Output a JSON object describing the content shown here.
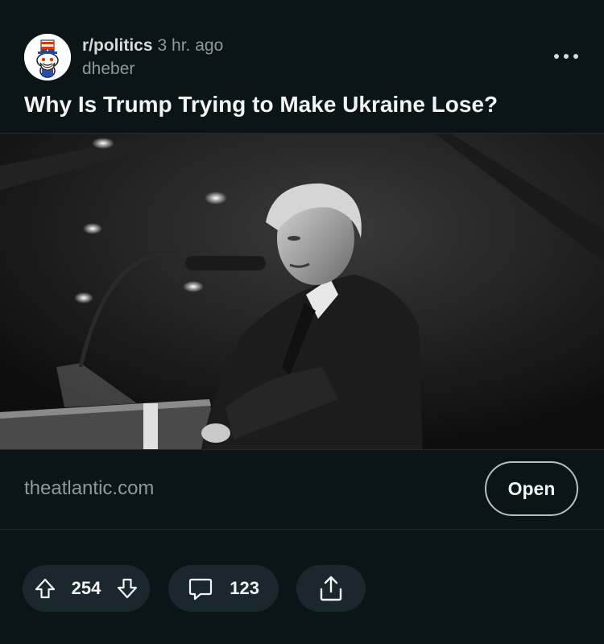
{
  "post": {
    "subreddit": "r/politics",
    "time": "3 hr. ago",
    "author": "dheber",
    "title": "Why Is Trump Trying to Make Ukraine Lose?"
  },
  "link": {
    "domain": "theatlantic.com",
    "open_label": "Open"
  },
  "actions": {
    "upvote_count": "254",
    "comment_count": "123"
  },
  "icons": {
    "avatar": "subreddit-avatar-icon",
    "more": "more-options-icon",
    "upvote": "upvote-arrow-icon",
    "downvote": "downvote-arrow-icon",
    "comment": "comment-bubble-icon",
    "share": "share-icon"
  }
}
